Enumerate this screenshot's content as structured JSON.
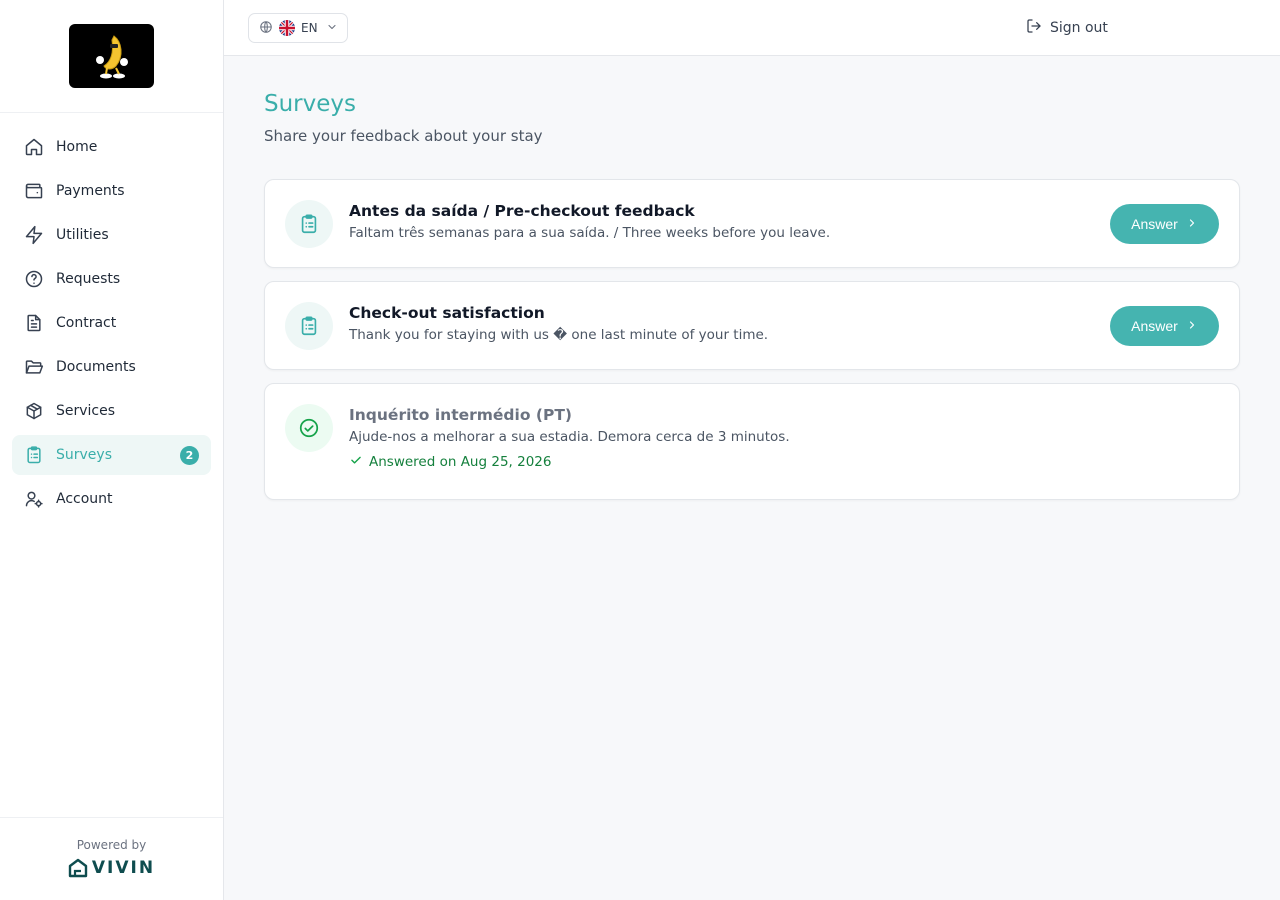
{
  "sidebar": {
    "logo": "logo",
    "items": [
      {
        "label": "Home",
        "icon": "home-icon"
      },
      {
        "label": "Payments",
        "icon": "wallet-icon"
      },
      {
        "label": "Utilities",
        "icon": "bolt-icon"
      },
      {
        "label": "Requests",
        "icon": "help-circle-icon"
      },
      {
        "label": "Contract",
        "icon": "document-icon"
      },
      {
        "label": "Documents",
        "icon": "folder-icon"
      },
      {
        "label": "Services",
        "icon": "package-icon"
      },
      {
        "label": "Surveys",
        "icon": "clipboard-icon",
        "active": true,
        "badge": "2"
      },
      {
        "label": "Account",
        "icon": "user-gear-icon"
      }
    ],
    "powered_by": "Powered by",
    "brand": "VIVIN"
  },
  "topbar": {
    "language": "EN",
    "sign_out": "Sign out"
  },
  "main": {
    "title": "Surveys",
    "subtitle": "Share your feedback about your stay",
    "surveys": [
      {
        "title": "Antes da saída / Pre-checkout feedback",
        "description": "Faltam três semanas para a sua saída. / Three weeks before you leave.",
        "action": "Answer",
        "status": "pending"
      },
      {
        "title": "Check-out satisfaction",
        "description": "Thank you for staying with us � one last minute of your time.",
        "action": "Answer",
        "status": "pending"
      },
      {
        "title": "Inquérito intermédio (PT)",
        "description": "Ajude-nos a melhorar a sua estadia. Demora cerca de 3 minutos.",
        "answered": "Answered on Aug 25, 2026",
        "status": "answered"
      }
    ]
  },
  "colors": {
    "accent": "#3aaeaa",
    "button": "#45b4b0",
    "success": "#16a34a",
    "active_bg": "#eef7f6"
  }
}
